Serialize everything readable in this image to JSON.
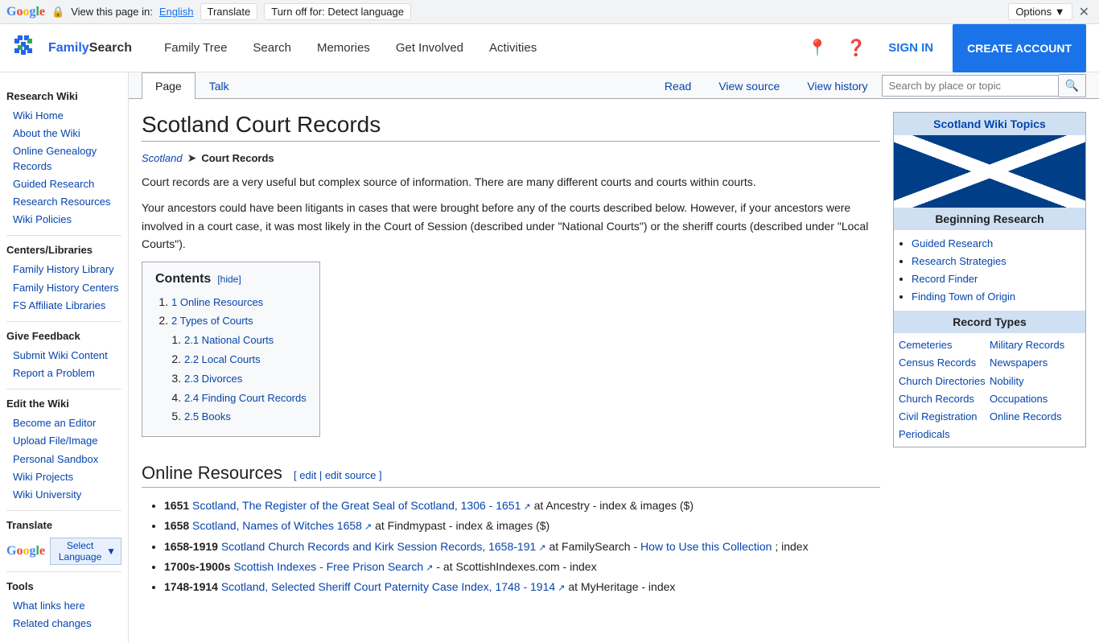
{
  "translate_bar": {
    "view_text": "View this page in:",
    "language": "English",
    "translate_btn": "Translate",
    "turnoff_btn": "Turn off for: Detect language",
    "options_btn": "Options ▼"
  },
  "nav": {
    "logo_text": "FamilySearch",
    "links": [
      "Family Tree",
      "Search",
      "Memories",
      "Get Involved",
      "Activities"
    ],
    "sign_in": "SIGN IN",
    "create_account": "CREATE ACCOUNT"
  },
  "sidebar": {
    "section_research": "Research Wiki",
    "links_research": [
      "Wiki Home",
      "About the Wiki",
      "Online Genealogy Records",
      "Guided Research",
      "Research Resources",
      "Wiki Policies"
    ],
    "section_centers": "Centers/Libraries",
    "links_centers": [
      "Family History Library",
      "Family History Centers",
      "FS Affiliate Libraries"
    ],
    "section_feedback": "Give Feedback",
    "links_feedback": [
      "Submit Wiki Content",
      "Report a Problem"
    ],
    "section_edit": "Edit the Wiki",
    "links_edit": [
      "Become an Editor",
      "Upload File/Image",
      "Personal Sandbox",
      "Wiki Projects",
      "Wiki University"
    ],
    "section_translate": "Translate",
    "section_tools": "Tools",
    "tools_links": [
      "What links here",
      "Related changes"
    ],
    "select_language": "Select Language"
  },
  "page_tabs": {
    "tabs": [
      "Page",
      "Talk",
      "Read",
      "View source",
      "View history"
    ],
    "active_tab": "Page",
    "search_placeholder": "Search by place or topic"
  },
  "article": {
    "title": "Scotland Court Records",
    "breadcrumb_country": "Scotland",
    "breadcrumb_current": "Court Records",
    "intro1": "Court records are a very useful but complex source of information. There are many different courts and courts within courts.",
    "intro2": "Your ancestors could have been litigants in cases that were brought before any of the courts described below. However, if your ancestors were involved in a court case, it was most likely in the Court of Session (described under \"National Courts\") or the sheriff courts (described under \"Local Courts\").",
    "toc_title": "Contents",
    "toc_hide": "[hide]",
    "toc_items": [
      {
        "num": "1",
        "text": "Online Resources"
      },
      {
        "num": "2",
        "text": "Types of Courts"
      }
    ],
    "toc_sub_items": [
      {
        "num": "2.1",
        "text": "National Courts"
      },
      {
        "num": "2.2",
        "text": "Local Courts"
      },
      {
        "num": "2.3",
        "text": "Divorces"
      },
      {
        "num": "2.4",
        "text": "Finding Court Records"
      },
      {
        "num": "2.5",
        "text": "Books"
      }
    ],
    "online_resources_heading": "Online Resources",
    "edit_link": "edit",
    "edit_source_link": "edit source",
    "resources": [
      {
        "year": "1651",
        "title": "Scotland, The Register of the Great Seal of Scotland, 1306 - 1651",
        "suffix": " at Ancestry - index & images ($)"
      },
      {
        "year": "1658",
        "title": "Scotland, Names of Witches 1658",
        "suffix": " at Findmypast - index & images ($)"
      },
      {
        "year": "1658-1919",
        "title": "Scotland Church Records and Kirk Session Records, 1658-191",
        "suffix": " at FamilySearch - How to Use this Collection; index"
      },
      {
        "year": "1700s-1900s",
        "title": "Scottish Indexes - Free Prison Search",
        "suffix": " - at ScottishIndexes.com - index"
      },
      {
        "year": "1748-1914",
        "title": "Scotland, Selected Sheriff Court Paternity Case Index, 1748 - 1914",
        "suffix": " at MyHeritage - index"
      }
    ]
  },
  "right_sidebar": {
    "topics_title": "Scotland Wiki Topics",
    "beginning_research_title": "Beginning Research",
    "beginning_links": [
      "Guided Research",
      "Research Strategies",
      "Record Finder",
      "Finding Town of Origin"
    ],
    "record_types_title": "Record Types",
    "record_types": [
      "Cemeteries",
      "Military Records",
      "Census Records",
      "Newspapers",
      "Church Directories",
      "Nobility",
      "Church Records",
      "Occupations",
      "Civil Registration",
      "Online Records",
      "Periodicals"
    ]
  }
}
